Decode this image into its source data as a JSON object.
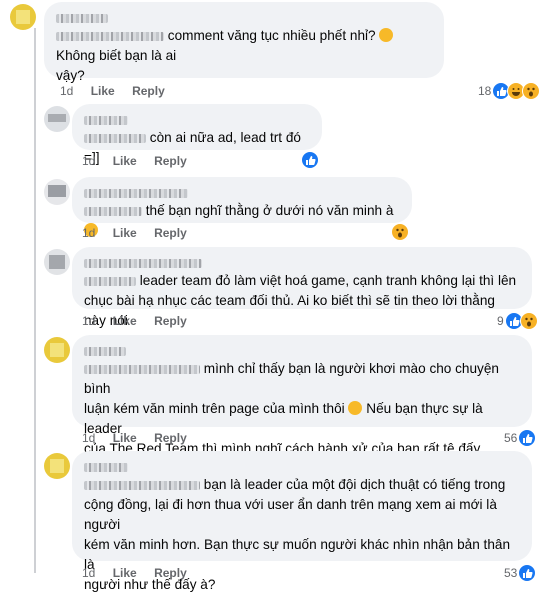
{
  "comments": [
    {
      "text": "comment văng tục nhiều phết nhỉ? 😮 Không biết bạn là ai vậy?",
      "line1": "comment văng tục nhiều phết nhỉ?",
      "line1b": "Không biết bạn là ai",
      "line2": "vậy?",
      "time": "1d",
      "like": "Like",
      "reply": "Reply",
      "count": "18"
    },
    {
      "line1": "còn ai nữa ad, lead trt đó =]]",
      "time": "1d",
      "like": "Like",
      "reply": "Reply",
      "count": ""
    },
    {
      "line1": "thế bạn nghĩ thằng ở dưới nó văn minh à",
      "time": "1d",
      "like": "Like",
      "reply": "Reply",
      "count": ""
    },
    {
      "line1": "leader team đỏ làm việt hoá game, cạnh tranh không lại thì lên",
      "line2": "chục bài hạ nhục các team đối thủ. Ai ko biết thì sẽ tin theo lời thằng này nói",
      "time": "1d",
      "like": "Like",
      "reply": "Reply",
      "count": "9"
    },
    {
      "line1": "mình chỉ thấy bạn là người khơi mào cho chuyện bình",
      "line2": "luận kém văn minh trên page của mình thôi",
      "line2b": "Nếu bạn thực sự là leader",
      "line3": "của The Red Team thì mình nghĩ cách hành xử của bạn rất tệ đấy.",
      "time": "1d",
      "like": "Like",
      "reply": "Reply",
      "count": "56"
    },
    {
      "line1": "bạn là leader của một đội dịch thuật có tiếng trong",
      "line2": "cộng đồng, lại đi hơn thua với user ẩn danh trên mạng xem ai mới là người",
      "line3": "kém văn minh hơn. Bạn thực sự muốn người khác nhìn nhận bản thân là",
      "line4": "người như thế đấy à?",
      "time": "1d",
      "like": "Like",
      "reply": "Reply",
      "count": "53"
    }
  ],
  "colors": {
    "like": "#1877f2",
    "emoji": "#f7b125",
    "bubble": "#f0f2f5",
    "meta": "#65676b"
  }
}
